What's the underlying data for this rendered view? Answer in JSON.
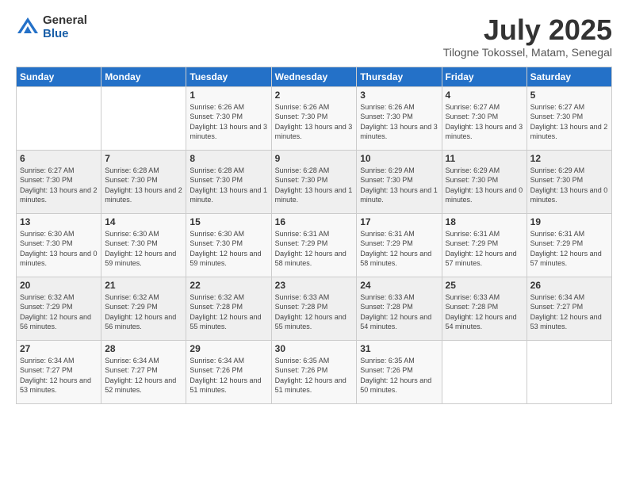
{
  "logo": {
    "general": "General",
    "blue": "Blue"
  },
  "title": "July 2025",
  "subtitle": "Tilogne Tokossel, Matam, Senegal",
  "headers": [
    "Sunday",
    "Monday",
    "Tuesday",
    "Wednesday",
    "Thursday",
    "Friday",
    "Saturday"
  ],
  "weeks": [
    [
      {
        "day": "",
        "detail": ""
      },
      {
        "day": "",
        "detail": ""
      },
      {
        "day": "1",
        "detail": "Sunrise: 6:26 AM\nSunset: 7:30 PM\nDaylight: 13 hours and 3 minutes."
      },
      {
        "day": "2",
        "detail": "Sunrise: 6:26 AM\nSunset: 7:30 PM\nDaylight: 13 hours and 3 minutes."
      },
      {
        "day": "3",
        "detail": "Sunrise: 6:26 AM\nSunset: 7:30 PM\nDaylight: 13 hours and 3 minutes."
      },
      {
        "day": "4",
        "detail": "Sunrise: 6:27 AM\nSunset: 7:30 PM\nDaylight: 13 hours and 3 minutes."
      },
      {
        "day": "5",
        "detail": "Sunrise: 6:27 AM\nSunset: 7:30 PM\nDaylight: 13 hours and 2 minutes."
      }
    ],
    [
      {
        "day": "6",
        "detail": "Sunrise: 6:27 AM\nSunset: 7:30 PM\nDaylight: 13 hours and 2 minutes."
      },
      {
        "day": "7",
        "detail": "Sunrise: 6:28 AM\nSunset: 7:30 PM\nDaylight: 13 hours and 2 minutes."
      },
      {
        "day": "8",
        "detail": "Sunrise: 6:28 AM\nSunset: 7:30 PM\nDaylight: 13 hours and 1 minute."
      },
      {
        "day": "9",
        "detail": "Sunrise: 6:28 AM\nSunset: 7:30 PM\nDaylight: 13 hours and 1 minute."
      },
      {
        "day": "10",
        "detail": "Sunrise: 6:29 AM\nSunset: 7:30 PM\nDaylight: 13 hours and 1 minute."
      },
      {
        "day": "11",
        "detail": "Sunrise: 6:29 AM\nSunset: 7:30 PM\nDaylight: 13 hours and 0 minutes."
      },
      {
        "day": "12",
        "detail": "Sunrise: 6:29 AM\nSunset: 7:30 PM\nDaylight: 13 hours and 0 minutes."
      }
    ],
    [
      {
        "day": "13",
        "detail": "Sunrise: 6:30 AM\nSunset: 7:30 PM\nDaylight: 13 hours and 0 minutes."
      },
      {
        "day": "14",
        "detail": "Sunrise: 6:30 AM\nSunset: 7:30 PM\nDaylight: 12 hours and 59 minutes."
      },
      {
        "day": "15",
        "detail": "Sunrise: 6:30 AM\nSunset: 7:30 PM\nDaylight: 12 hours and 59 minutes."
      },
      {
        "day": "16",
        "detail": "Sunrise: 6:31 AM\nSunset: 7:29 PM\nDaylight: 12 hours and 58 minutes."
      },
      {
        "day": "17",
        "detail": "Sunrise: 6:31 AM\nSunset: 7:29 PM\nDaylight: 12 hours and 58 minutes."
      },
      {
        "day": "18",
        "detail": "Sunrise: 6:31 AM\nSunset: 7:29 PM\nDaylight: 12 hours and 57 minutes."
      },
      {
        "day": "19",
        "detail": "Sunrise: 6:31 AM\nSunset: 7:29 PM\nDaylight: 12 hours and 57 minutes."
      }
    ],
    [
      {
        "day": "20",
        "detail": "Sunrise: 6:32 AM\nSunset: 7:29 PM\nDaylight: 12 hours and 56 minutes."
      },
      {
        "day": "21",
        "detail": "Sunrise: 6:32 AM\nSunset: 7:29 PM\nDaylight: 12 hours and 56 minutes."
      },
      {
        "day": "22",
        "detail": "Sunrise: 6:32 AM\nSunset: 7:28 PM\nDaylight: 12 hours and 55 minutes."
      },
      {
        "day": "23",
        "detail": "Sunrise: 6:33 AM\nSunset: 7:28 PM\nDaylight: 12 hours and 55 minutes."
      },
      {
        "day": "24",
        "detail": "Sunrise: 6:33 AM\nSunset: 7:28 PM\nDaylight: 12 hours and 54 minutes."
      },
      {
        "day": "25",
        "detail": "Sunrise: 6:33 AM\nSunset: 7:28 PM\nDaylight: 12 hours and 54 minutes."
      },
      {
        "day": "26",
        "detail": "Sunrise: 6:34 AM\nSunset: 7:27 PM\nDaylight: 12 hours and 53 minutes."
      }
    ],
    [
      {
        "day": "27",
        "detail": "Sunrise: 6:34 AM\nSunset: 7:27 PM\nDaylight: 12 hours and 53 minutes."
      },
      {
        "day": "28",
        "detail": "Sunrise: 6:34 AM\nSunset: 7:27 PM\nDaylight: 12 hours and 52 minutes."
      },
      {
        "day": "29",
        "detail": "Sunrise: 6:34 AM\nSunset: 7:26 PM\nDaylight: 12 hours and 51 minutes."
      },
      {
        "day": "30",
        "detail": "Sunrise: 6:35 AM\nSunset: 7:26 PM\nDaylight: 12 hours and 51 minutes."
      },
      {
        "day": "31",
        "detail": "Sunrise: 6:35 AM\nSunset: 7:26 PM\nDaylight: 12 hours and 50 minutes."
      },
      {
        "day": "",
        "detail": ""
      },
      {
        "day": "",
        "detail": ""
      }
    ]
  ]
}
